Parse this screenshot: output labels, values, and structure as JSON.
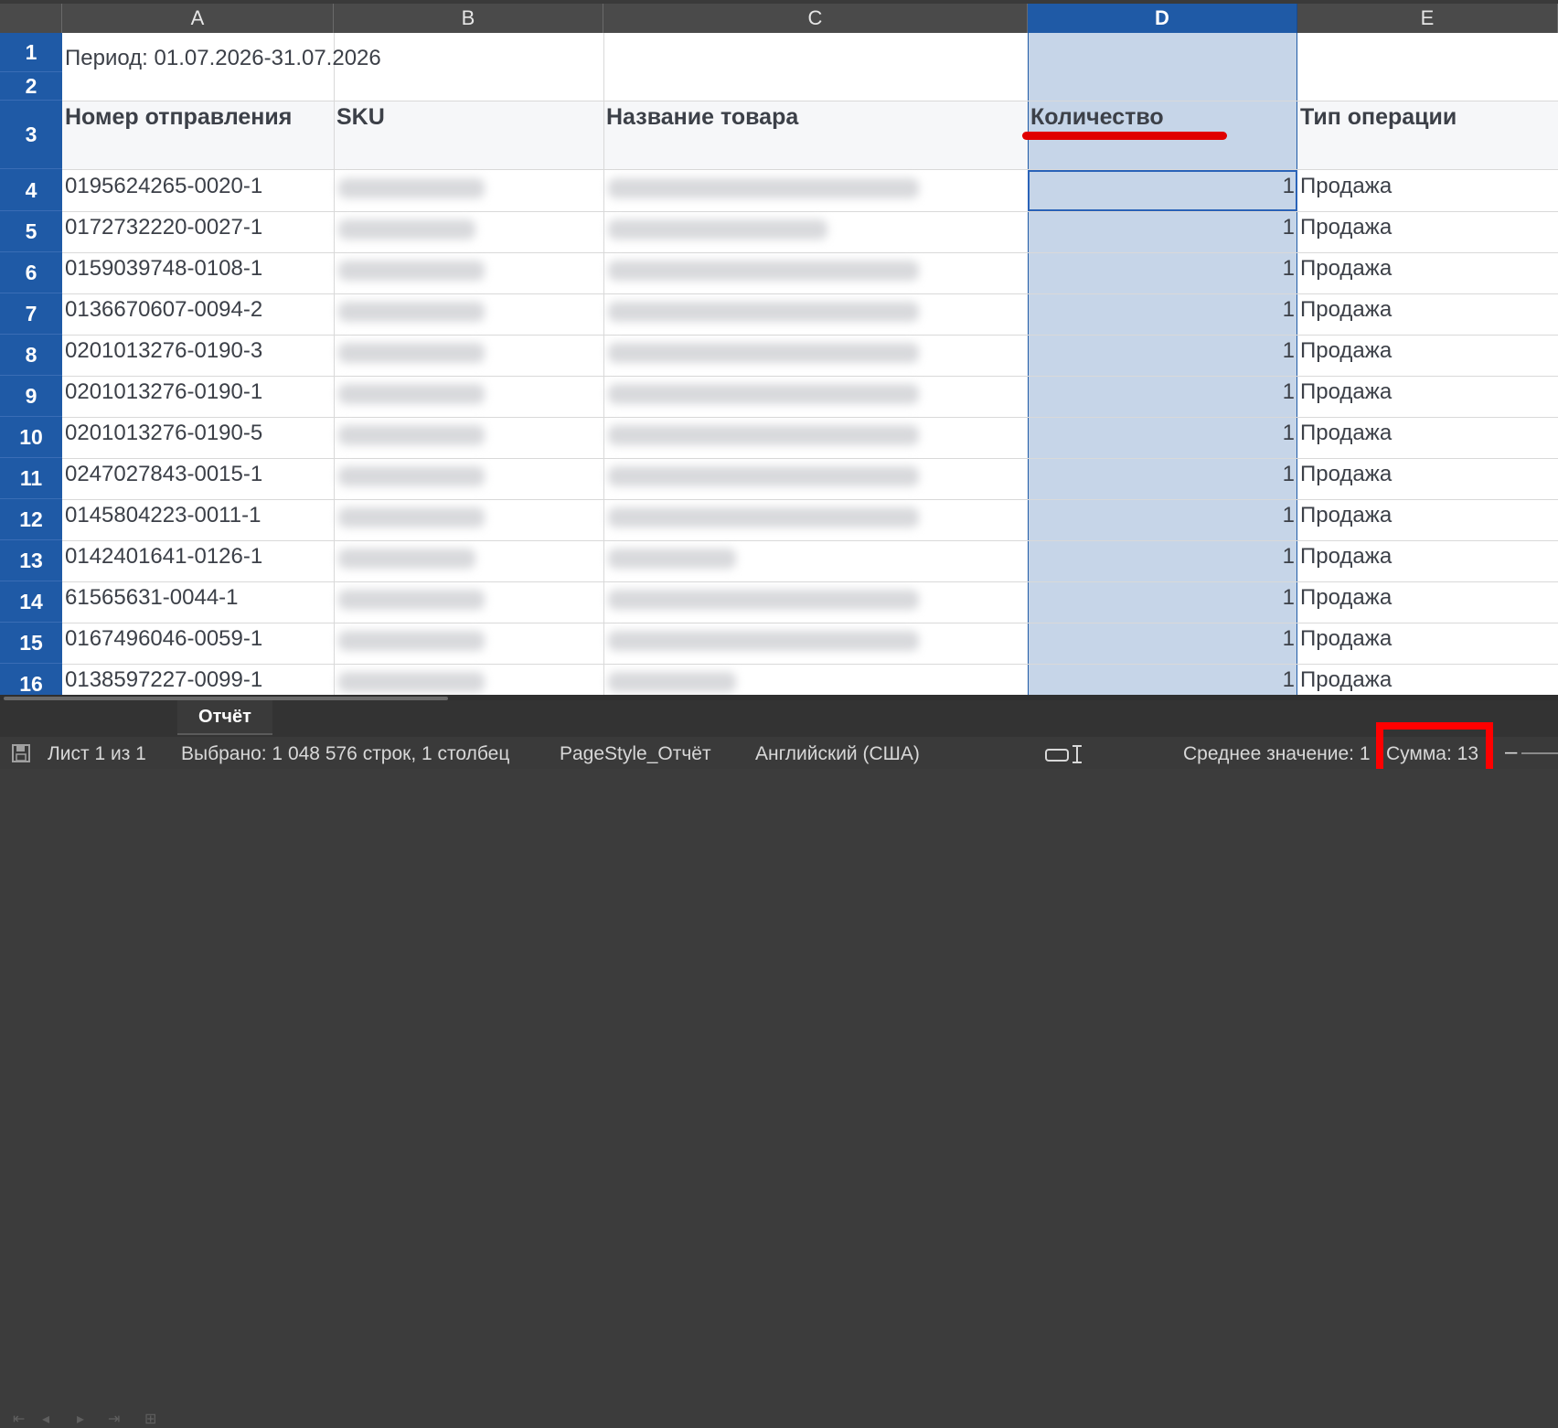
{
  "columns": [
    "A",
    "B",
    "C",
    "D",
    "E"
  ],
  "selected_column": "D",
  "period": "Период: 01.07.2026-31.07.2026",
  "headers": {
    "shipment": "Номер отправления",
    "sku": "SKU",
    "name": "Название товара",
    "quantity": "Количество",
    "operation": "Тип операции"
  },
  "row_numbers": [
    "1",
    "2",
    "3",
    "4",
    "5",
    "6",
    "7",
    "8",
    "9",
    "10",
    "11",
    "12",
    "13",
    "14",
    "15",
    "16"
  ],
  "rows": [
    {
      "shipment": "0195624265-0020-1",
      "quantity": "1",
      "operation": "Продажа"
    },
    {
      "shipment": "0172732220-0027-1",
      "quantity": "1",
      "operation": "Продажа"
    },
    {
      "shipment": "0159039748-0108-1",
      "quantity": "1",
      "operation": "Продажа"
    },
    {
      "shipment": "0136670607-0094-2",
      "quantity": "1",
      "operation": "Продажа"
    },
    {
      "shipment": "0201013276-0190-3",
      "quantity": "1",
      "operation": "Продажа"
    },
    {
      "shipment": "0201013276-0190-1",
      "quantity": "1",
      "operation": "Продажа"
    },
    {
      "shipment": "0201013276-0190-5",
      "quantity": "1",
      "operation": "Продажа"
    },
    {
      "shipment": "0247027843-0015-1",
      "quantity": "1",
      "operation": "Продажа"
    },
    {
      "shipment": "0145804223-0011-1",
      "quantity": "1",
      "operation": "Продажа"
    },
    {
      "shipment": "0142401641-0126-1",
      "quantity": "1",
      "operation": "Продажа"
    },
    {
      "shipment": "61565631-0044-1",
      "quantity": "1",
      "operation": "Продажа"
    },
    {
      "shipment": "0167496046-0059-1",
      "quantity": "1",
      "operation": "Продажа"
    },
    {
      "shipment": "0138597227-0099-1",
      "quantity": "1",
      "operation": "Продажа"
    }
  ],
  "sheet_tab": "Отчёт",
  "status": {
    "sheet": "Лист 1 из 1",
    "selection": "Выбрано: 1 048 576 строк, 1 столбец",
    "page_style": "PageStyle_Отчёт",
    "language": "Английский (США)",
    "average": "Среднее значение: 1",
    "sum": "Сумма: 13"
  },
  "colors": {
    "selection_blue": "#1f5aa6",
    "selected_fill": "#c6d5e8",
    "annotation_red": "#ff0000"
  }
}
